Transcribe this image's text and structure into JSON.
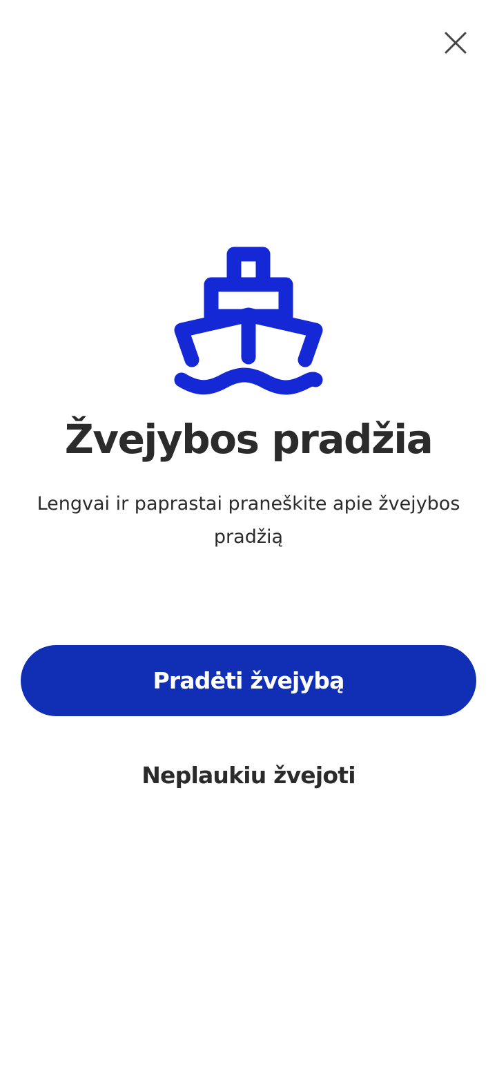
{
  "header": {
    "close_icon": "close-icon"
  },
  "hero": {
    "icon": "ship-icon",
    "icon_color": "#1428d6"
  },
  "content": {
    "title": "Žvejybos pradžia",
    "subtitle": "Lengvai ir paprastai praneškite apie žvejybos pradžią"
  },
  "actions": {
    "primary_label": "Pradėti žvejybą",
    "primary_color": "#102fb5",
    "secondary_label": "Neplaukiu žvejoti"
  }
}
